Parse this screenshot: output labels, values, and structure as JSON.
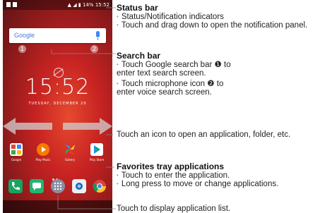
{
  "phone": {
    "status_bar_time": "15:52",
    "status_bar_battery": "14%",
    "search_brand": "Google",
    "callout_1": "1",
    "callout_2": "2",
    "clock_time": "15:52",
    "clock_date": "TUESDAY, DECEMBER 20",
    "favorites": [
      {
        "label": "Google",
        "icon": "google-apps-icon"
      },
      {
        "label": "Play Music",
        "icon": "play-music-icon"
      },
      {
        "label": "Gallery",
        "icon": "gallery-icon"
      },
      {
        "label": "Play Store",
        "icon": "play-store-icon"
      }
    ],
    "dock": [
      "phone-icon",
      "messages-icon",
      "app-drawer-icon",
      "camera-icon",
      "chrome-icon"
    ]
  },
  "annotations": {
    "status_bar": {
      "title": "Status bar",
      "bullets": [
        "Status/Notification indicators",
        "Touch and drag down to open the notification panel."
      ]
    },
    "search_bar": {
      "title": "Search bar",
      "bullets": [
        "Touch Google search bar ❶ to enter text search screen.",
        "Touch microphone icon ❷ to enter voice search screen."
      ]
    },
    "icons_note": "Touch an icon to open an application, folder, etc.",
    "favorites_tray": {
      "title": "Favorites tray applications",
      "bullets": [
        "Touch to enter the application.",
        "Long press to move or change applications."
      ]
    },
    "app_list_note": "Touch to display application list."
  },
  "colors": {
    "wallpaper": "#c72322",
    "google_blue": "#4285f4"
  }
}
